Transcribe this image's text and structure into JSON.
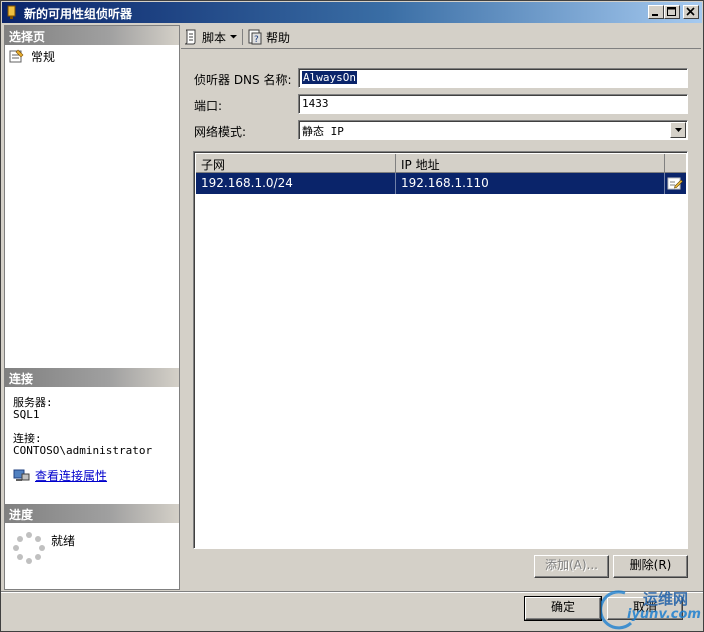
{
  "window": {
    "title": "新的可用性组侦听器"
  },
  "left_pane": {
    "select_page_header": "选择页",
    "pages": [
      {
        "label": "常规",
        "icon": "properties-page-icon"
      }
    ],
    "connection_header": "连接",
    "server_label": "服务器:",
    "server_value": "SQL1",
    "connection_label": "连接:",
    "connection_value": "CONTOSO\\administrator",
    "view_connection_properties": "查看连接属性",
    "progress_header": "进度",
    "progress_status": "就绪"
  },
  "toolbar": {
    "script_label": "脚本",
    "help_label": "帮助"
  },
  "form": {
    "dns_label": "侦听器 DNS 名称:",
    "dns_value": "AlwaysOn",
    "port_label": "端口:",
    "port_value": "1433",
    "network_mode_label": "网络模式:",
    "network_mode_value": "静态 IP"
  },
  "grid": {
    "columns": [
      "子网",
      "IP 地址"
    ],
    "rows": [
      {
        "subnet": "192.168.1.0/24",
        "ip": "192.168.1.110"
      }
    ]
  },
  "buttons": {
    "add": "添加(A)...",
    "remove": "删除(R)",
    "ok": "确定",
    "cancel": "取消"
  },
  "watermark": {
    "line1": "运维网",
    "line2": "iyunv.com"
  },
  "colors": {
    "title_start": "#0a246a",
    "title_end": "#a6caf0",
    "selection": "#0a246a",
    "link": "#0000cc"
  }
}
